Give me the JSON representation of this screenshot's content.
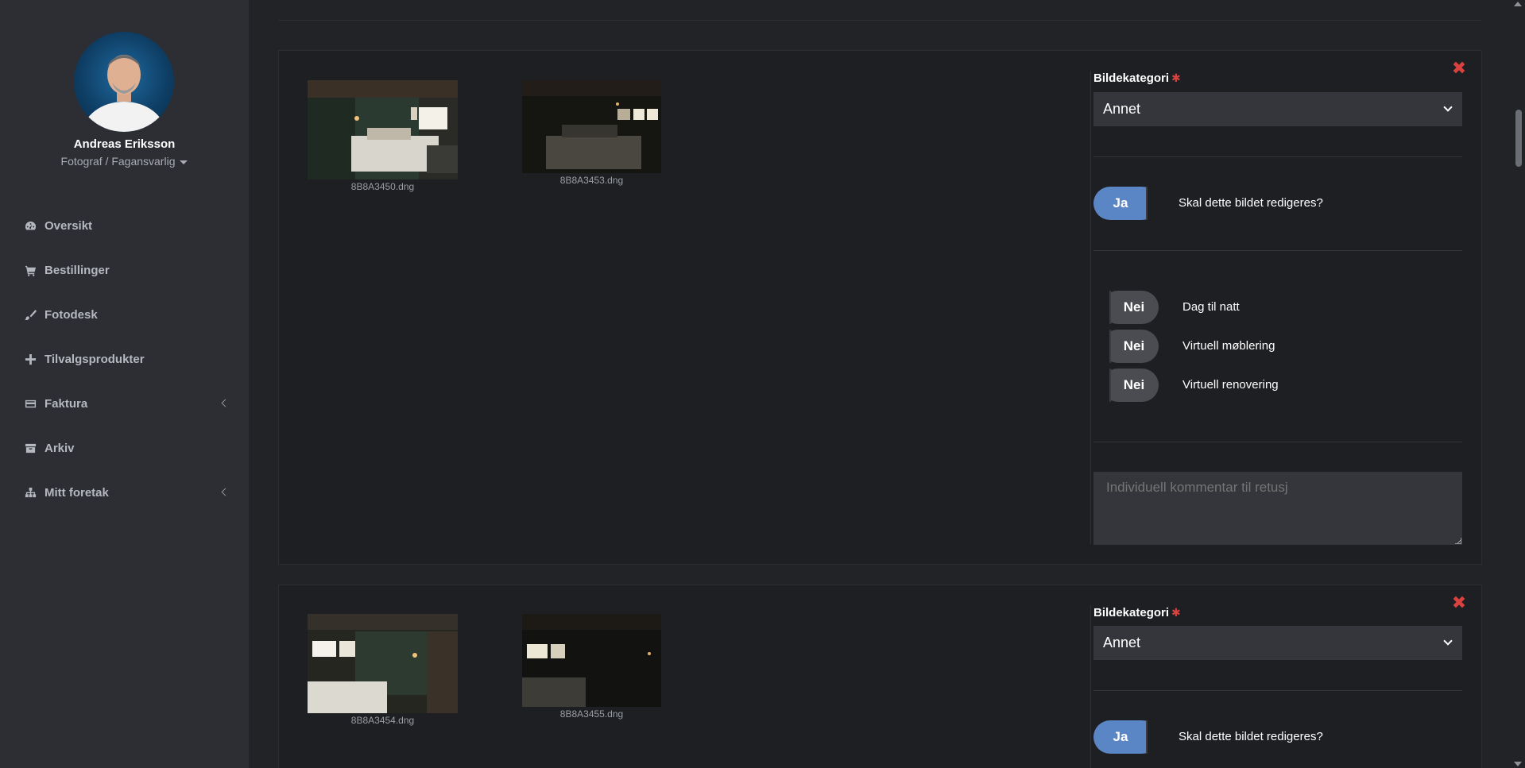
{
  "user": {
    "name": "Andreas Eriksson",
    "role": "Fotograf / Fagansvarlig"
  },
  "nav": {
    "items": [
      {
        "label": "Oversikt",
        "icon": "dashboard-icon",
        "has_submenu": false
      },
      {
        "label": "Bestillinger",
        "icon": "cart-icon",
        "has_submenu": false
      },
      {
        "label": "Fotodesk",
        "icon": "brush-icon",
        "has_submenu": false
      },
      {
        "label": "Tilvalgsprodukter",
        "icon": "plus-icon",
        "has_submenu": false
      },
      {
        "label": "Faktura",
        "icon": "credit-card-icon",
        "has_submenu": true
      },
      {
        "label": "Arkiv",
        "icon": "archive-icon",
        "has_submenu": false
      },
      {
        "label": "Mitt foretak",
        "icon": "sitemap-icon",
        "has_submenu": true
      }
    ]
  },
  "cards": [
    {
      "images": [
        "8B8A3450.dng",
        "8B8A3453.dng"
      ],
      "category_label": "Bildekategori",
      "category_value": "Annet",
      "edit_toggle": "Ja",
      "edit_question": "Skal dette bildet redigeres?",
      "options": [
        {
          "toggle": "Nei",
          "label": "Dag til natt"
        },
        {
          "toggle": "Nei",
          "label": "Virtuell møblering"
        },
        {
          "toggle": "Nei",
          "label": "Virtuell renovering"
        }
      ],
      "comment_placeholder": "Individuell kommentar til retusj"
    },
    {
      "images": [
        "8B8A3454.dng",
        "8B8A3455.dng"
      ],
      "category_label": "Bildekategori",
      "category_value": "Annet",
      "edit_toggle": "Ja",
      "edit_question": "Skal dette bildet redigeres?"
    }
  ],
  "colors": {
    "sidebar_bg": "#2c2e33",
    "page_bg": "#222327",
    "card_bg": "#1e1f23",
    "toggle_on": "#5b86c6",
    "toggle_off": "#4a4c52",
    "required": "#d9423f"
  }
}
